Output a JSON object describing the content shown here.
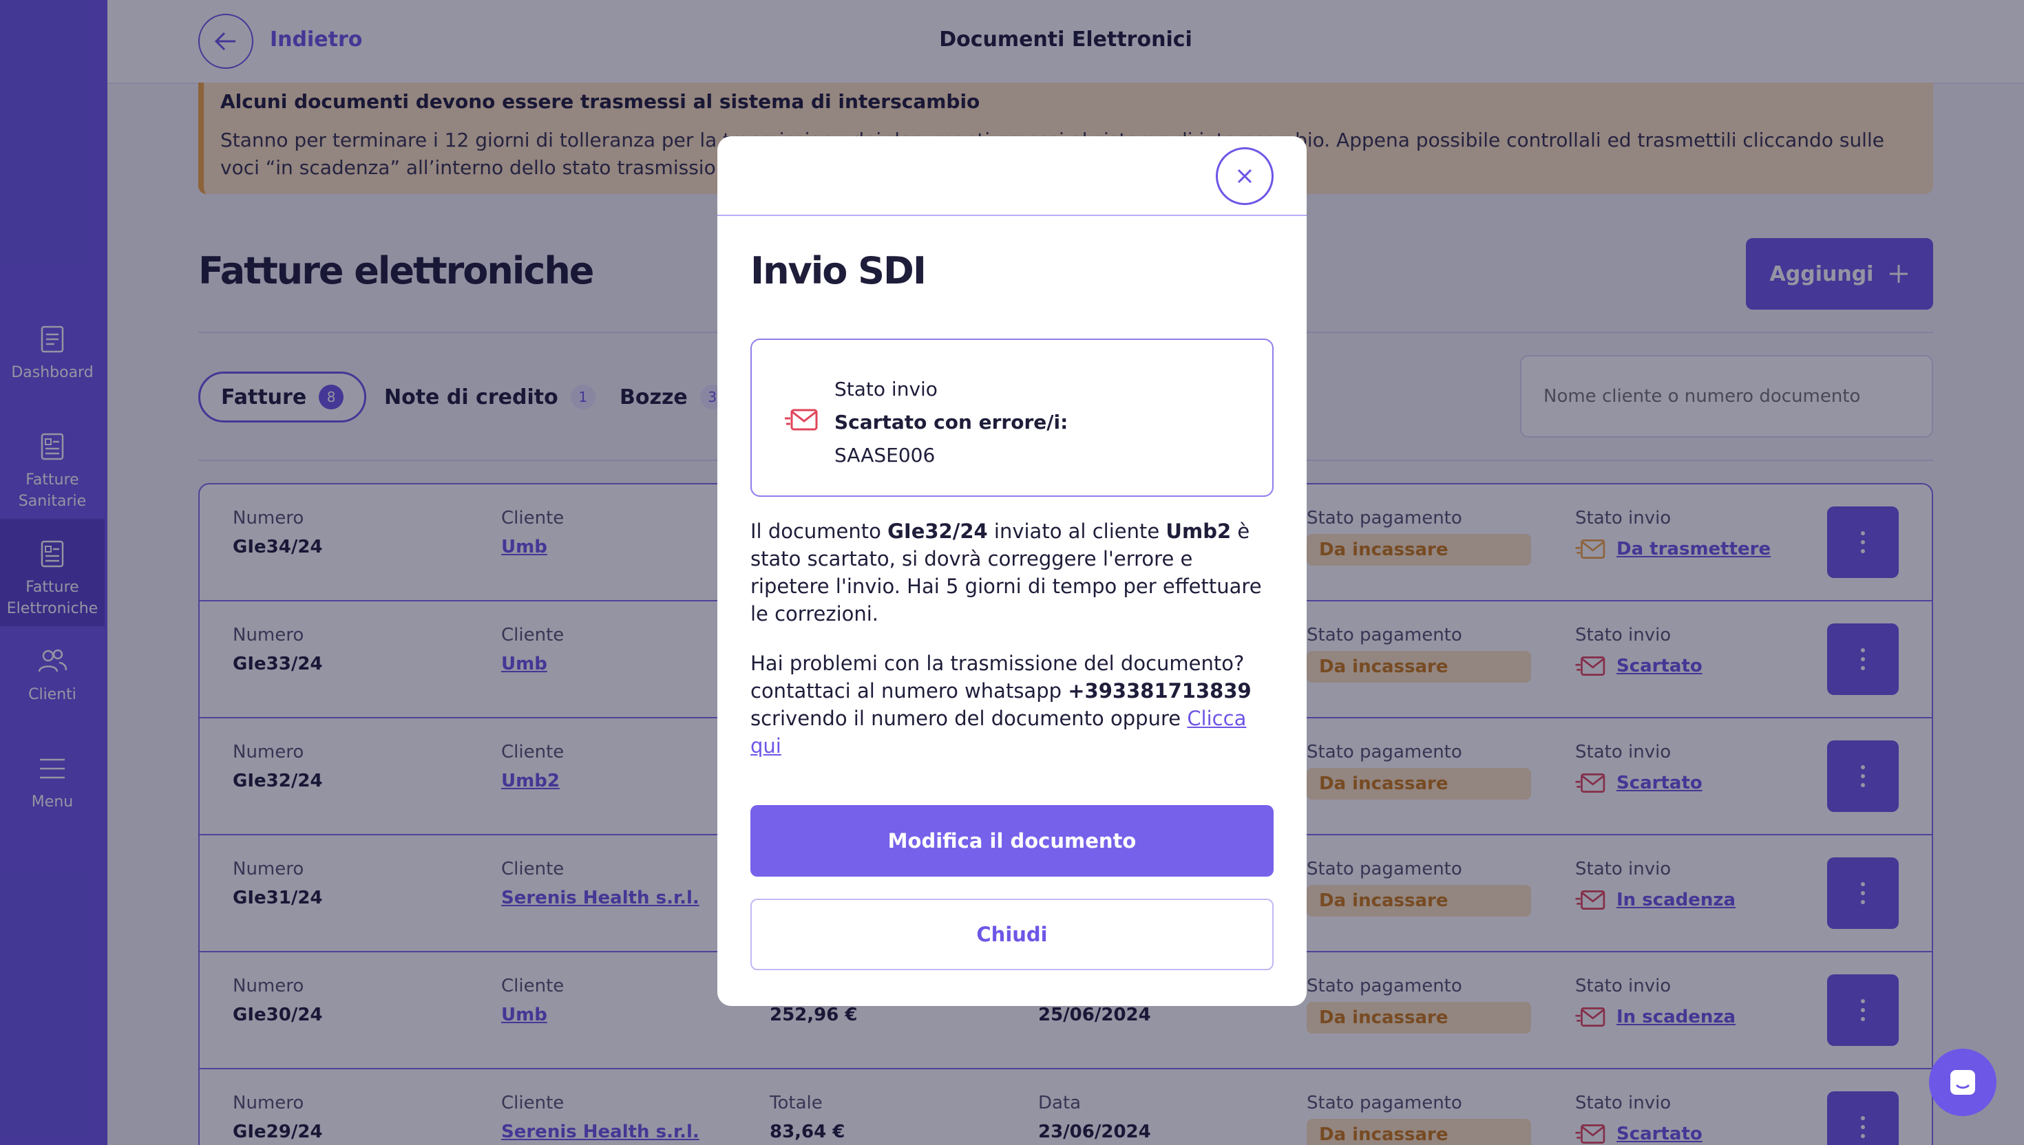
{
  "colors": {
    "accent": "#6c57e6",
    "warning": "#f0a640",
    "danger": "#e0455a"
  },
  "sidebar": {
    "items": [
      {
        "label": "Dashboard",
        "icon": "document-icon"
      },
      {
        "label": "Fatture Sanitarie",
        "icon": "invoice-icon"
      },
      {
        "label": "Fatture Elettroniche",
        "icon": "invoice-icon",
        "active": true
      },
      {
        "label": "Clienti",
        "icon": "users-icon"
      },
      {
        "label": "Menu",
        "icon": "menu-icon"
      }
    ]
  },
  "header": {
    "back_label": "Indietro",
    "title": "Documenti Elettronici"
  },
  "alert": {
    "title": "Alcuni documenti devono essere trasmessi al sistema di interscambio",
    "text": "Stanno per terminare i 12 giorni di tolleranza per la trasmissione dei documenti emessi al sistema di interscambio. Appena possibile controllali ed trasmettili cliccando sulle voci “in scadenza” all’interno dello stato trasmissione, altrimenti verrà applicata una sanzione."
  },
  "page": {
    "title": "Fatture elettroniche",
    "add_label": "Aggiungi"
  },
  "tabs": [
    {
      "label": "Fatture",
      "count": "8"
    },
    {
      "label": "Note di credito",
      "count": "1"
    },
    {
      "label": "Bozze",
      "count": "3"
    }
  ],
  "search": {
    "placeholder": "Nome cliente o numero documento"
  },
  "table": {
    "labels": {
      "number": "Numero",
      "client": "Cliente",
      "total": "Totale",
      "date": "Data",
      "payment": "Stato pagamento",
      "send": "Stato invio"
    },
    "rows": [
      {
        "number": "GIe34/24",
        "client": "Umb",
        "total": "",
        "date": "",
        "payment": "Da incassare",
        "send": "Da trasmettere"
      },
      {
        "number": "GIe33/24",
        "client": "Umb",
        "total": "",
        "date": "",
        "payment": "Da incassare",
        "send": "Scartato"
      },
      {
        "number": "GIe32/24",
        "client": "Umb2",
        "total": "",
        "date": "",
        "payment": "Da incassare",
        "send": "Scartato"
      },
      {
        "number": "GIe31/24",
        "client": "Serenis Health s.r.l.",
        "total": "",
        "date": "",
        "payment": "Da incassare",
        "send": "In scadenza"
      },
      {
        "number": "GIe30/24",
        "client": "Umb",
        "total": "252,96 €",
        "date": "25/06/2024",
        "payment": "Da incassare",
        "send": "In scadenza"
      },
      {
        "number": "GIe29/24",
        "client": "Serenis Health s.r.l.",
        "total": "83,64 €",
        "date": "23/06/2024",
        "payment": "Da incassare",
        "send": "Scartato"
      }
    ]
  },
  "modal": {
    "title": "Invio SDI",
    "status_label": "Stato invio",
    "status_value": "Scartato con errore/i:",
    "error_code": "SAASE006",
    "para1": {
      "p1": "Il documento ",
      "doc": "GIe32/24",
      "p2": " inviato al cliente ",
      "client": "Umb2",
      "p3": " è stato scartato, si dovrà correggere l'errore e ripetere l'invio. Hai 5 giorni di tempo per effettuare le correzioni."
    },
    "para2": {
      "p1": "Hai problemi con la trasmissione del documento? contattaci al numero whatsapp ",
      "phone": "+393381713839",
      "p2": " scrivendo il numero del documento oppure ",
      "link": "Clicca qui"
    },
    "primary_label": "Modifica il documento",
    "secondary_label": "Chiudi"
  }
}
